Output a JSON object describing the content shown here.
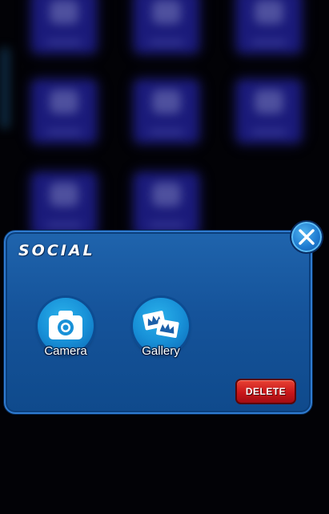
{
  "folder": {
    "title": "SOCIAL",
    "apps": [
      {
        "label": "Camera",
        "icon": "camera-icon"
      },
      {
        "label": "Gallery",
        "icon": "gallery-icon"
      }
    ],
    "delete_label": "DELETE",
    "close_icon": "close-icon"
  },
  "colors": {
    "panel": "#15539a",
    "panel_border": "#2f7bd0",
    "app_circle": "#1891d8",
    "delete": "#c8161a"
  }
}
